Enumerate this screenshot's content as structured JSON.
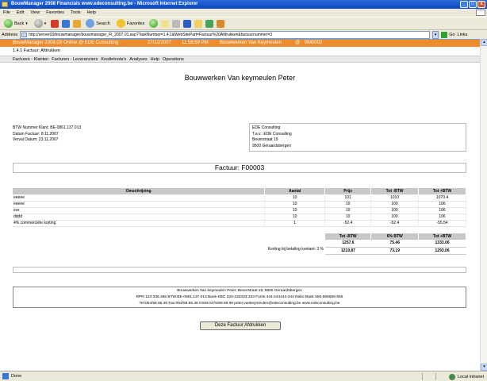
{
  "window": {
    "title": "BouwManager 2008 Financials www.edeconsulting.be - Microsoft Internet Explorer"
  },
  "menu": [
    "File",
    "Edit",
    "View",
    "Favorites",
    "Tools",
    "Help"
  ],
  "toolbar": {
    "back": "Back",
    "search": "Search",
    "favorites": "Favorites"
  },
  "address": {
    "label": "Address",
    "url": "http://server03/bouwmanager/bouwmanager_FI_2007.01.asp?TaskNumber=1.4.1&WebSitePart=Factuur%20Afdrukken&factuurnummer=3",
    "go": "Go",
    "links": "Links"
  },
  "app_header": {
    "product": "BouwManager 2008.03",
    "online": "Online @ EDE Consulting",
    "date": "27/12/2007",
    "time": "11:58:59 PM",
    "project": "Bouwwerken Van Keymeulen",
    "at": "@",
    "code": "BM0002"
  },
  "breadcrumb": "1.4.1 Factuur: Afdrukken",
  "nav": [
    "Facturen - Klanten",
    "Facturen - Leveranciers",
    "Kredietnota's",
    "Analyses",
    "Help",
    "Operations"
  ],
  "invoice": {
    "company": "Bouwwerken Van keymeulen Peter",
    "btw_klant": "BTW Nummer Klant: BE-0861.137.013",
    "datum": "Datum Factuur: 8.11.2007",
    "verval": "Verval Datum: 23.11.2007",
    "client_address": [
      "EDE Consulting",
      "T.a.v.: EDE Consulting",
      "Beverstraat 19",
      "9500 Geraardsbergen"
    ],
    "number": "Factuur: F00003",
    "columns": [
      "Omschrijving",
      "Aantal",
      "Prijs",
      "Tot -BTW",
      "Tot +BTW"
    ],
    "rows": [
      [
        "eeeee",
        "10",
        "101",
        "1010",
        "1070.4"
      ],
      [
        "eeeee",
        "10",
        "10",
        "100",
        "106"
      ],
      [
        "sss",
        "10",
        "10",
        "100",
        "106"
      ],
      [
        "dddd",
        "10",
        "10",
        "100",
        "106"
      ],
      [
        "4% commerciële korting",
        "1",
        "-52.4",
        "-52.4",
        "-55.54"
      ]
    ],
    "totals_columns": [
      "Tot -BTW",
      "6% BTW",
      "Tot +BTW"
    ],
    "totals_row": [
      "1257.6",
      "75.46",
      "1333.06"
    ],
    "korting_label": "Korting bij betaling kontant: 3 %",
    "korting_row": [
      "1219.87",
      "73.19",
      "1293.06"
    ],
    "footer": [
      "Bouwwerken Van keymeulen Peter, Beverstraat 19, 9500 Geraardsbergen",
      "RPR:123-336.366  BTW:BE-0861.137.013  Bank-KBC 333-333333-333  Fortis 444-444444-444  Rabo Bank 555-555555-555",
      "Tel:054/58.85.46  Fax:054/58.85.46  GSM:0475/99.99.99  peter.vankeymeulen@edeconsulting.be  www.edeconsulting.be"
    ],
    "print_button": "Deze Factuur Afdrukken"
  },
  "status": {
    "left": "Done",
    "zone": "Local intranet"
  },
  "colors": {
    "header_orange": "#f08c2c",
    "table_header": "#c8c8c8",
    "chrome": "#ece9d8"
  }
}
